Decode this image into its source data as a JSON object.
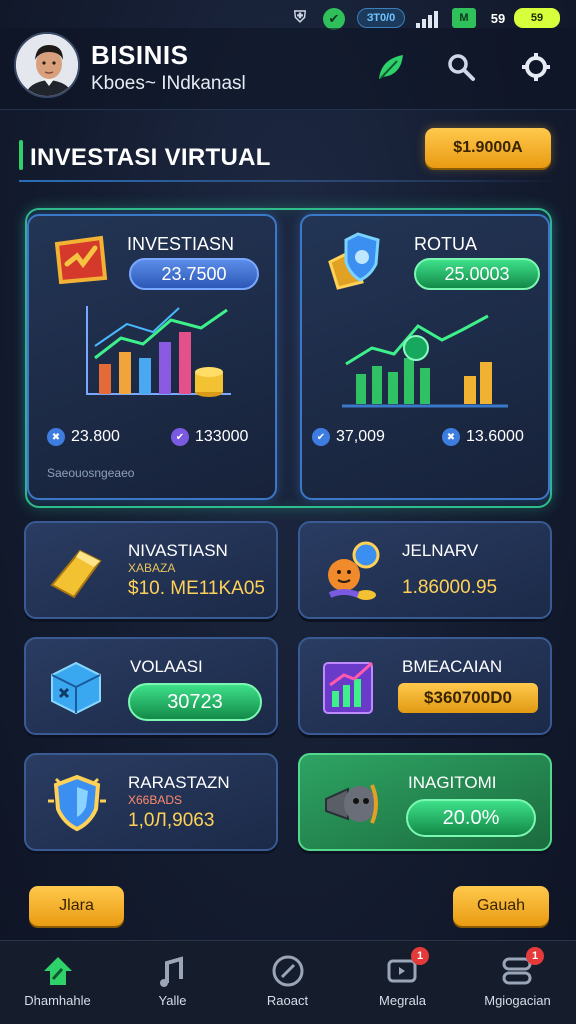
{
  "status_bar": {
    "pill": "ЗТ0/0",
    "chip": "M",
    "number": "59",
    "battery": "59"
  },
  "header": {
    "title": "BISINIS",
    "subtitle": "Kboes~ INdkanasl"
  },
  "section": {
    "title": "INVESTASI VIRTUAL",
    "action_label": "$1.9000A"
  },
  "featured": [
    {
      "title": "INVESTIASN",
      "amount": "23.7500",
      "stat_1": "23.800",
      "stat_2": "133000",
      "footer": "Saeouosngeaeo"
    },
    {
      "title": "ROTUA",
      "amount": "25.0003",
      "stat_1": "37,009",
      "stat_2": "13.6000"
    }
  ],
  "cards": [
    {
      "title": "NIVASTIASN",
      "sub": "XABAZA",
      "value": "$10. ME11KA05"
    },
    {
      "title": "JELNARV",
      "value": "1.86000.95"
    },
    {
      "title": "VOLAASI",
      "value": "30723"
    },
    {
      "title": "BMEACAIAN",
      "value": "$360700D0"
    },
    {
      "title": "RARASTAZN",
      "sub": "X66BADS",
      "value": "1,0Л,9063"
    },
    {
      "title": "INAGITOMI",
      "value": "20.0%"
    }
  ],
  "buttons": {
    "left": "Jlara",
    "right": "Gauah"
  },
  "tabs": [
    {
      "label": "Dhamhahle"
    },
    {
      "label": "Yalle"
    },
    {
      "label": "Raoact"
    },
    {
      "label": "Megrala",
      "badge": "1"
    },
    {
      "label": "Mgiogacian",
      "badge": "1"
    }
  ]
}
